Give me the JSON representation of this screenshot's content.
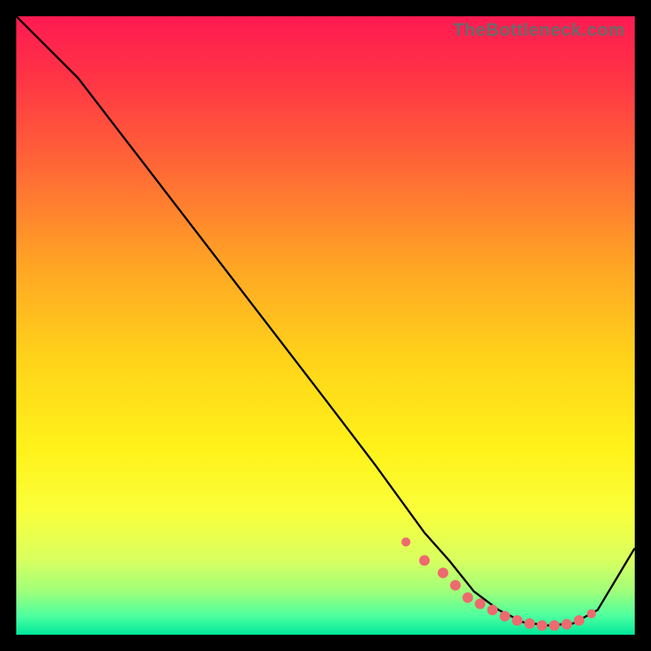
{
  "watermark": "TheBottleneck.com",
  "colors": {
    "line": "#000000",
    "marker": "#ed6a6f",
    "background_top": "#ff1a52",
    "background_bottom": "#00e89a",
    "frame": "#000000"
  },
  "chart_data": {
    "type": "line",
    "title": "",
    "xlabel": "",
    "ylabel": "",
    "xlim": [
      0,
      100
    ],
    "ylim": [
      0,
      100
    ],
    "grid": false,
    "legend": false,
    "series": [
      {
        "name": "bottleneck-curve",
        "x": [
          0,
          4,
          10,
          20,
          30,
          40,
          50,
          58,
          62,
          66,
          70,
          74,
          78,
          82,
          86,
          90,
          94,
          100
        ],
        "y": [
          100,
          96,
          90,
          77,
          64,
          51,
          38,
          27.5,
          22,
          16.5,
          12,
          7,
          4,
          2,
          1.5,
          1.8,
          4,
          14
        ]
      }
    ],
    "markers": {
      "name": "highlight-range",
      "x": [
        63,
        66,
        69,
        71,
        73,
        75,
        77,
        79,
        81,
        83,
        85,
        87,
        89,
        91,
        93
      ],
      "y": [
        15,
        12,
        10,
        8,
        6,
        5,
        4,
        3,
        2.3,
        1.8,
        1.5,
        1.5,
        1.7,
        2.3,
        3.4
      ]
    }
  }
}
